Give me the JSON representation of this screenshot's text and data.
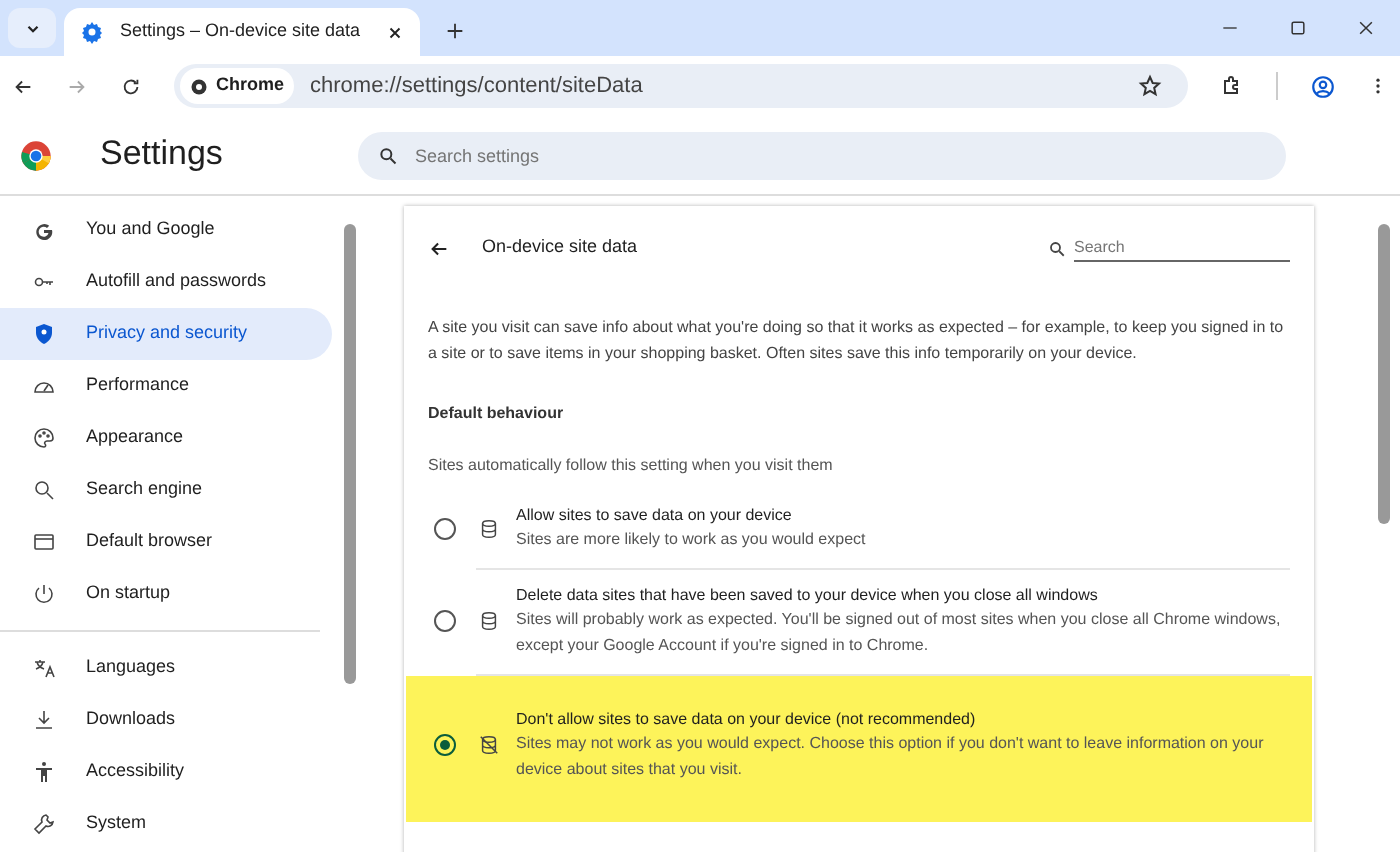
{
  "browser": {
    "tab_title": "Settings – On-device site data",
    "address_chip": "Chrome",
    "url": "chrome://settings/content/siteData"
  },
  "header": {
    "title": "Settings",
    "search_placeholder": "Search settings"
  },
  "sidebar": {
    "groups": [
      [
        {
          "label": "You and Google",
          "selected": false
        },
        {
          "label": "Autofill and passwords",
          "selected": false
        },
        {
          "label": "Privacy and security",
          "selected": true
        },
        {
          "label": "Performance",
          "selected": false
        },
        {
          "label": "Appearance",
          "selected": false
        },
        {
          "label": "Search engine",
          "selected": false
        },
        {
          "label": "Default browser",
          "selected": false
        },
        {
          "label": "On startup",
          "selected": false
        }
      ],
      [
        {
          "label": "Languages",
          "selected": false
        },
        {
          "label": "Downloads",
          "selected": false
        },
        {
          "label": "Accessibility",
          "selected": false
        },
        {
          "label": "System",
          "selected": false
        }
      ]
    ]
  },
  "page": {
    "title": "On-device site data",
    "search_placeholder": "Search",
    "intro": "A site you visit can save info about what you're doing so that it works as expected – for example, to keep you signed in to a site or to save items in your shopping basket. Often sites save this info temporarily on your device.",
    "section_title": "Default behaviour",
    "section_subtitle": "Sites automatically follow this setting when you visit them",
    "options": [
      {
        "title": "Allow sites to save data on your device",
        "description": "Sites are more likely to work as you would expect",
        "selected": false,
        "highlighted": false
      },
      {
        "title": "Delete data sites that have been saved to your device when you close all windows",
        "description": "Sites will probably work as expected. You'll be signed out of most sites when you close all Chrome windows, except your Google Account if you're signed in to Chrome.",
        "selected": false,
        "highlighted": false
      },
      {
        "title": "Don't allow sites to save data on your device (not recommended)",
        "description": "Sites may not work as you would expect. Choose this option if you don't want to leave information on your device about sites that you visit.",
        "selected": true,
        "highlighted": true
      }
    ]
  }
}
